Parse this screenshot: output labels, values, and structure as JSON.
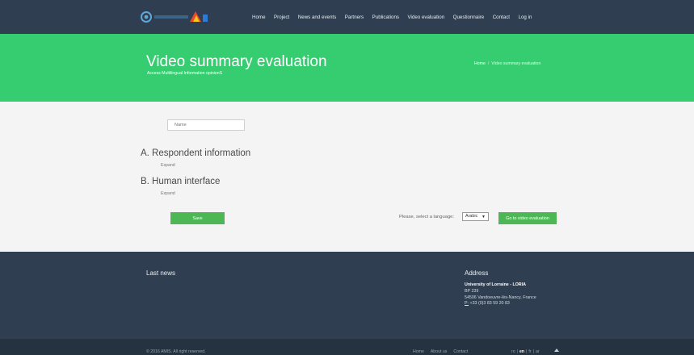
{
  "header": {
    "logo_alt": "AMIS",
    "nav": [
      {
        "label": "Home"
      },
      {
        "label": "Project"
      },
      {
        "label": "News and events"
      },
      {
        "label": "Partners"
      },
      {
        "label": "Publications"
      },
      {
        "label": "Video evaluation"
      },
      {
        "label": "Questionnaire"
      },
      {
        "label": "Contact"
      },
      {
        "label": "Log in"
      }
    ]
  },
  "hero": {
    "title": "Video summary evaluation",
    "subtitle": "Access Multilingual Information opinionS",
    "breadcrumb": {
      "home": "Home",
      "separator": "/",
      "current": "Video summary evaluation"
    }
  },
  "form": {
    "name_placeholder": "Name",
    "sections": [
      {
        "title": "A. Respondent information",
        "expand": "Expand"
      },
      {
        "title": "B. Human interface",
        "expand": "Expand"
      }
    ],
    "save_label": "Save",
    "language_label": "Please, select a language:",
    "language_selected": "Arabic",
    "go_label": "Go to video evaluation"
  },
  "footer": {
    "last_news_title": "Last news",
    "address_title": "Address",
    "address": {
      "org": "University of Lorraine - LORIA",
      "line1": "BP 239",
      "line2": "54506 Vandoeuvre-lès-Nancy, France",
      "phone_prefix": "P:",
      "phone": "+33 (0)3 83 59 20 83"
    },
    "copyright": "© 2016 AMIS. All right reserved.",
    "links": [
      {
        "label": "Home"
      },
      {
        "label": "About us"
      },
      {
        "label": "Contact"
      }
    ],
    "languages": [
      {
        "label": "en",
        "active": true
      },
      {
        "label": "fr"
      },
      {
        "label": "ar"
      }
    ],
    "languages_prefix": "ro"
  },
  "colors": {
    "topbar": "#2f3e51",
    "hero": "#36cd71",
    "button_green": "#4cb754",
    "footer": "#2f3e51",
    "bottom_bar": "#25323f"
  }
}
